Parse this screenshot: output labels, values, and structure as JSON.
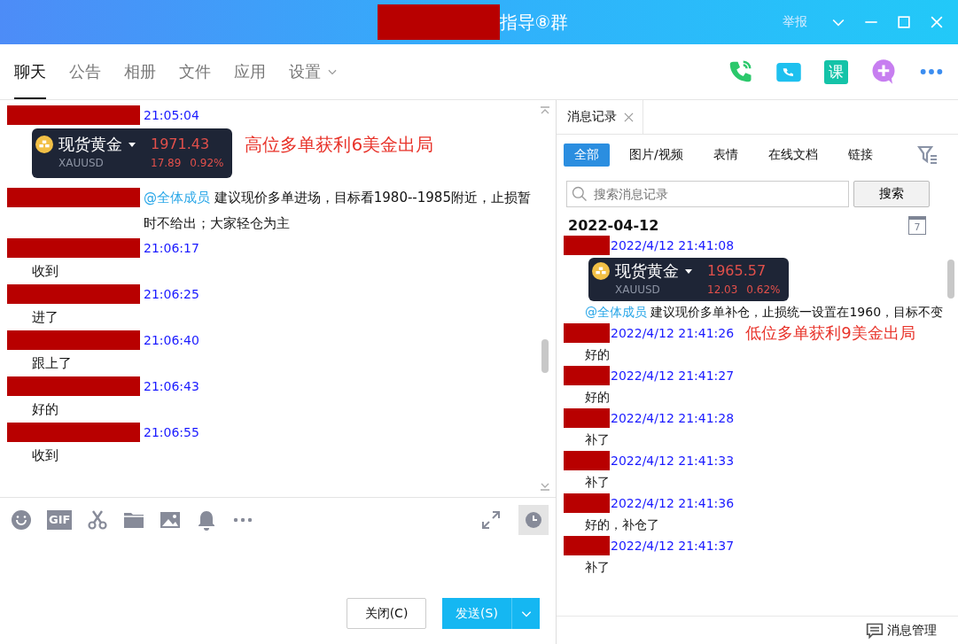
{
  "window": {
    "title": "指导⑧群",
    "title_redacted": true,
    "report": "举报"
  },
  "tabs": [
    {
      "label": "聊天",
      "selected": true
    },
    {
      "label": "公告",
      "selected": false
    },
    {
      "label": "相册",
      "selected": false
    },
    {
      "label": "文件",
      "selected": false
    },
    {
      "label": "应用",
      "selected": false
    },
    {
      "label": "设置",
      "selected": false,
      "dropdown": true
    }
  ],
  "header_actions": [
    {
      "kind": "phone"
    },
    {
      "kind": "video"
    },
    {
      "kind": "course",
      "label": "课"
    },
    {
      "kind": "add"
    },
    {
      "kind": "more"
    }
  ],
  "chat": {
    "messages": [
      {
        "kind": "block",
        "redacted": true,
        "time": "21:05:04",
        "parts": [
          {
            "kind": "quote",
            "name": "现货黄金",
            "symbol": "XAUUSD",
            "price": "1971.43",
            "change": "17.89",
            "percent": "0.92%"
          },
          {
            "kind": "alert",
            "text": "高位多单获利6美金出局"
          }
        ]
      },
      {
        "kind": "inline",
        "redacted": true,
        "parts": [
          {
            "kind": "paragraph",
            "mention": "@全体成员",
            "text": "建议现价多单进场，目标看1980--1985附近，止损暂时不给出；大家轻仓为主"
          }
        ]
      },
      {
        "kind": "block",
        "redacted": true,
        "time": "21:06:17",
        "parts": [
          {
            "kind": "text",
            "text": "收到"
          }
        ]
      },
      {
        "kind": "block",
        "redacted": true,
        "time": "21:06:25",
        "parts": [
          {
            "kind": "text",
            "text": "进了"
          }
        ]
      },
      {
        "kind": "block",
        "redacted": true,
        "time": "21:06:40",
        "parts": [
          {
            "kind": "text",
            "text": "跟上了"
          }
        ]
      },
      {
        "kind": "block",
        "redacted": true,
        "time": "21:06:43",
        "parts": [
          {
            "kind": "text",
            "text": "好的"
          }
        ]
      },
      {
        "kind": "block",
        "redacted": true,
        "time": "21:06:55",
        "parts": [
          {
            "kind": "text",
            "text": "收到"
          }
        ]
      }
    ]
  },
  "toolbar": [
    {
      "kind": "emoji"
    },
    {
      "kind": "gif",
      "label": "GIF"
    },
    {
      "kind": "scissors"
    },
    {
      "kind": "folder"
    },
    {
      "kind": "image"
    },
    {
      "kind": "bell"
    },
    {
      "kind": "more"
    }
  ],
  "toolbar_right": [
    {
      "kind": "expand",
      "active": false
    },
    {
      "kind": "clock",
      "active": true
    }
  ],
  "buttons": {
    "close": "关闭(C)",
    "send": "发送(S)"
  },
  "history": {
    "tab": "消息记录",
    "filters": [
      {
        "label": "全部",
        "selected": true
      },
      {
        "label": "图片/视频",
        "selected": false
      },
      {
        "label": "表情",
        "selected": false
      },
      {
        "label": "在线文档",
        "selected": false
      },
      {
        "label": "链接",
        "selected": false
      }
    ],
    "search": {
      "placeholder": "搜索消息记录",
      "button": "搜索"
    },
    "date": "2022-04-12",
    "calendar_day": "7",
    "messages": [
      {
        "kind": "block",
        "redacted": true,
        "time": "2022/4/12 21:41:08",
        "parts": [
          {
            "kind": "quote",
            "name": "现货黄金",
            "symbol": "XAUUSD",
            "price": "1965.57",
            "change": "12.03",
            "percent": "0.62%"
          },
          {
            "kind": "paragraph",
            "mention": "@全体成员",
            "text": "建议现价多单补仓，止损统一设置在1960，目标不变"
          }
        ]
      },
      {
        "kind": "block",
        "redacted": true,
        "time": "2022/4/12 21:41:26",
        "note": "低位多单获利9美金出局",
        "parts": [
          {
            "kind": "text",
            "text": "好的"
          }
        ]
      },
      {
        "kind": "block",
        "redacted": true,
        "time": "2022/4/12 21:41:27",
        "parts": [
          {
            "kind": "text",
            "text": "好的"
          }
        ]
      },
      {
        "kind": "block",
        "redacted": true,
        "time": "2022/4/12 21:41:28",
        "parts": [
          {
            "kind": "text",
            "text": "补了"
          }
        ]
      },
      {
        "kind": "block",
        "redacted": true,
        "time": "2022/4/12 21:41:33",
        "parts": [
          {
            "kind": "text",
            "text": "补了"
          }
        ]
      },
      {
        "kind": "block",
        "redacted": true,
        "time": "2022/4/12 21:41:36",
        "parts": [
          {
            "kind": "text",
            "text": "好的，补仓了"
          }
        ]
      },
      {
        "kind": "block",
        "redacted": true,
        "time": "2022/4/12 21:41:37",
        "parts": [
          {
            "kind": "text",
            "text": "补了"
          }
        ]
      }
    ],
    "footer": "消息管理"
  }
}
